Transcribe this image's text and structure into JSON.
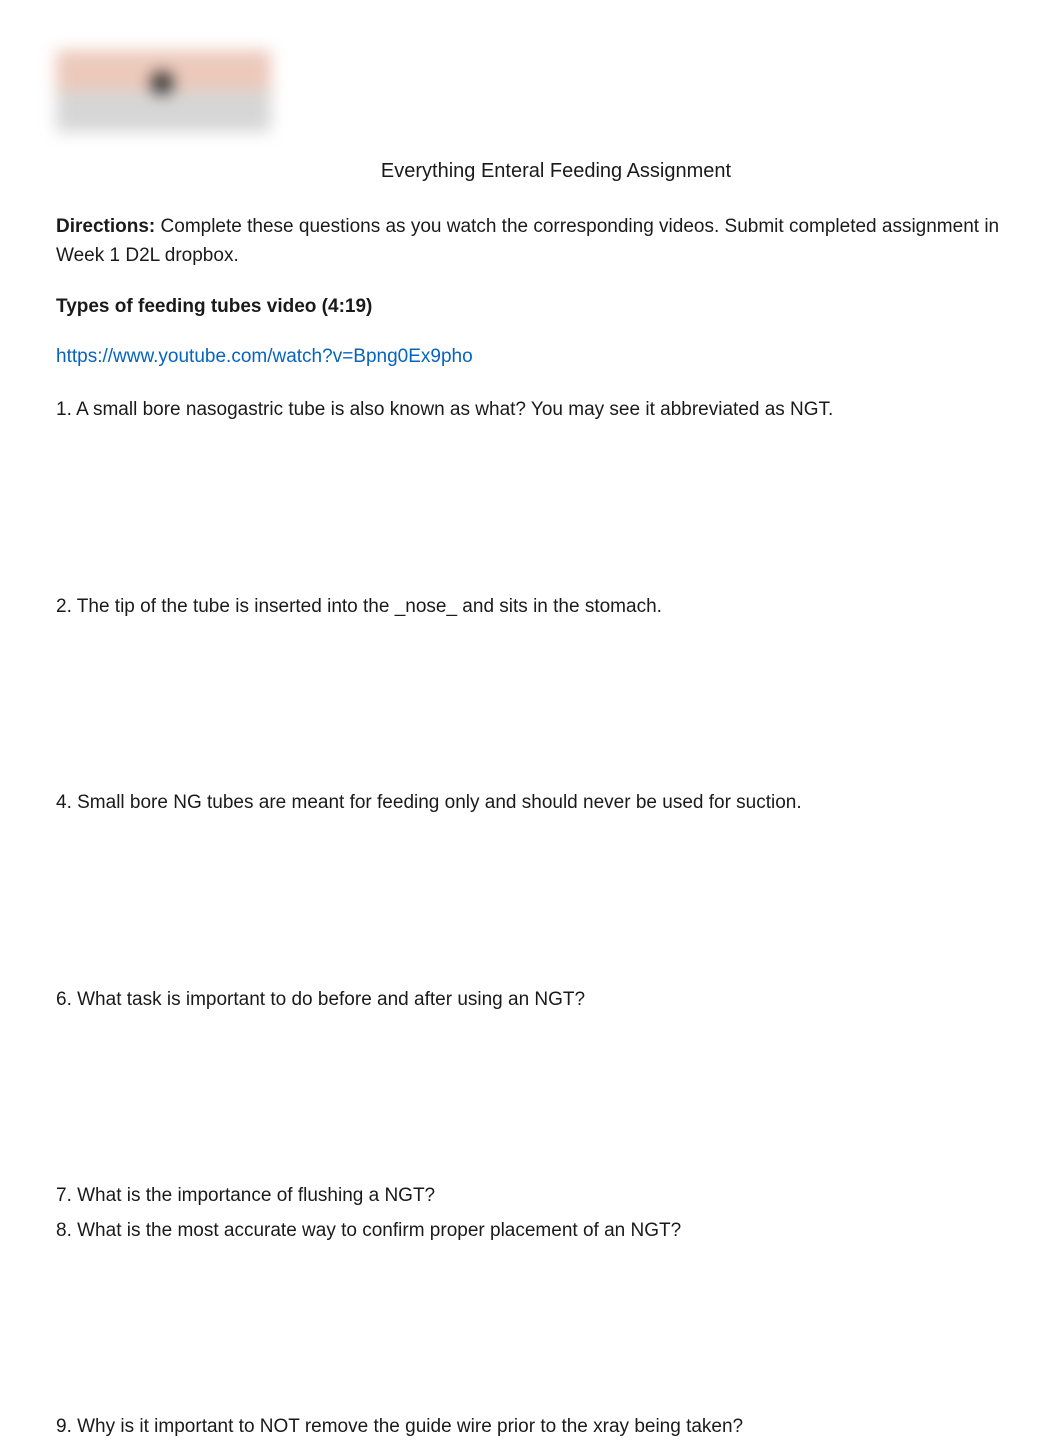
{
  "title": "Everything Enteral Feeding Assignment",
  "directions": {
    "label": "Directions:",
    "text": "  Complete these questions as you watch the corresponding videos.  Submit completed assignment in Week 1 D2L dropbox."
  },
  "section_heading": "Types of feeding tubes video   (4:19)",
  "link": "https://www.youtube.com/watch?v=Bpng0Ex9pho",
  "questions": {
    "q1": "1.  A small bore nasogastric tube is also known as what?          You may see it abbreviated as NGT.",
    "q2": "2.  The tip of the tube is inserted into the _nose_ and sits in the stomach.",
    "q4": "4.  Small bore NG tubes are meant for feeding only and should never be used for suction.",
    "q6": "6.  What task is important to do before and after using an NGT?",
    "q7": "7.  What is the importance of flushing a NGT?",
    "q8": "8.  What is the most accurate way to confirm proper placement of an NGT?",
    "q9": "9.  Why is it important to NOT remove the guide wire prior to the xray being taken?"
  }
}
